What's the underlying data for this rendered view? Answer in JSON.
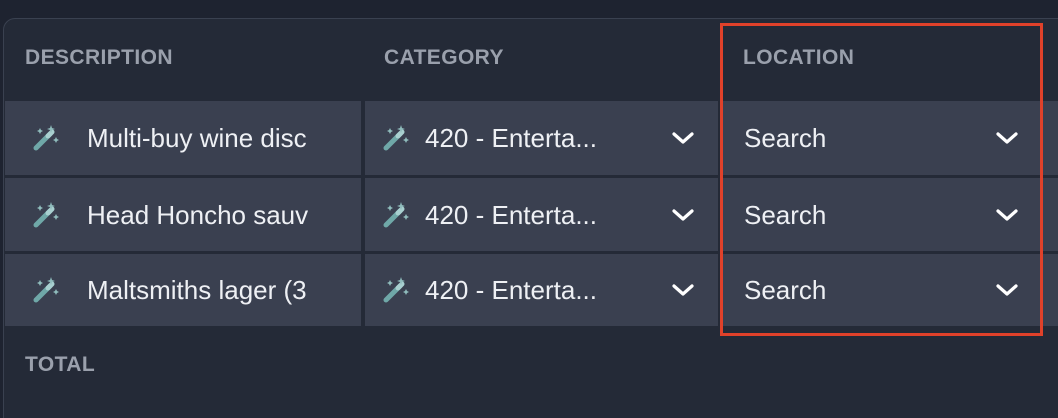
{
  "table": {
    "columns": {
      "description": "DESCRIPTION",
      "category": "CATEGORY",
      "location": "LOCATION"
    },
    "rows": [
      {
        "description": "Multi-buy wine disc",
        "category": "420 - Enterta...",
        "location": "Search"
      },
      {
        "description": "Head Honcho sauv",
        "category": "420 - Enterta...",
        "location": "Search"
      },
      {
        "description": "Maltsmiths lager (3",
        "category": "420 - Enterta...",
        "location": "Search"
      }
    ],
    "total_label": "TOTAL"
  },
  "icons": {
    "suggestion": "magic-wand-icon",
    "dropdown": "chevron-down-icon"
  },
  "colors": {
    "background": "#1e2330",
    "panel": "#242a37",
    "cell": "#3a4050",
    "header_text": "#9aa0ac",
    "cell_text": "#eef0f4",
    "wand_icon": "#6fa8a8",
    "highlight": "#e0412a"
  }
}
